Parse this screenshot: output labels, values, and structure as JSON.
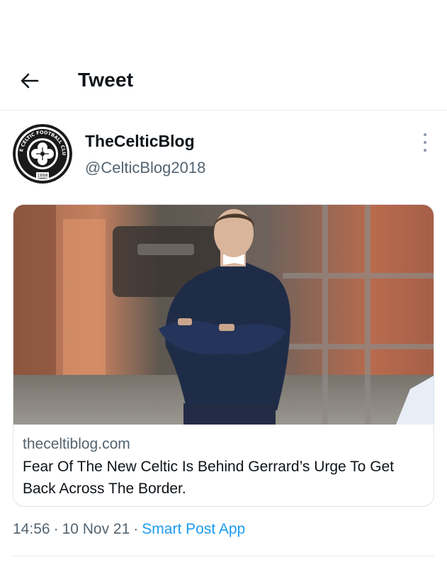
{
  "header": {
    "title": "Tweet",
    "back_icon": "arrow-left-icon"
  },
  "author": {
    "display_name": "TheCelticBlog",
    "handle": "@CelticBlog2018",
    "avatar_icon": "celtic-fc-crest-icon",
    "avatar_crest_text": "THE CELTIC FOOTBALL CLUB",
    "avatar_crest_year": "1888",
    "more_icon": "more-vertical-icon"
  },
  "card": {
    "domain": "theceltiblog.com",
    "title": "Fear Of The New Celtic Is Behind Gerrard’s Urge To Get Back Across The Border.",
    "image_icon": "man-in-sweater-arms-crossed-photo"
  },
  "meta": {
    "time": "14:56",
    "separator": "·",
    "date": "10 Nov 21",
    "source": "Smart Post App"
  },
  "colors": {
    "accent": "#1d9bf0",
    "text_primary": "#0f1419",
    "text_secondary": "#536471",
    "border": "#e6e9eb"
  }
}
